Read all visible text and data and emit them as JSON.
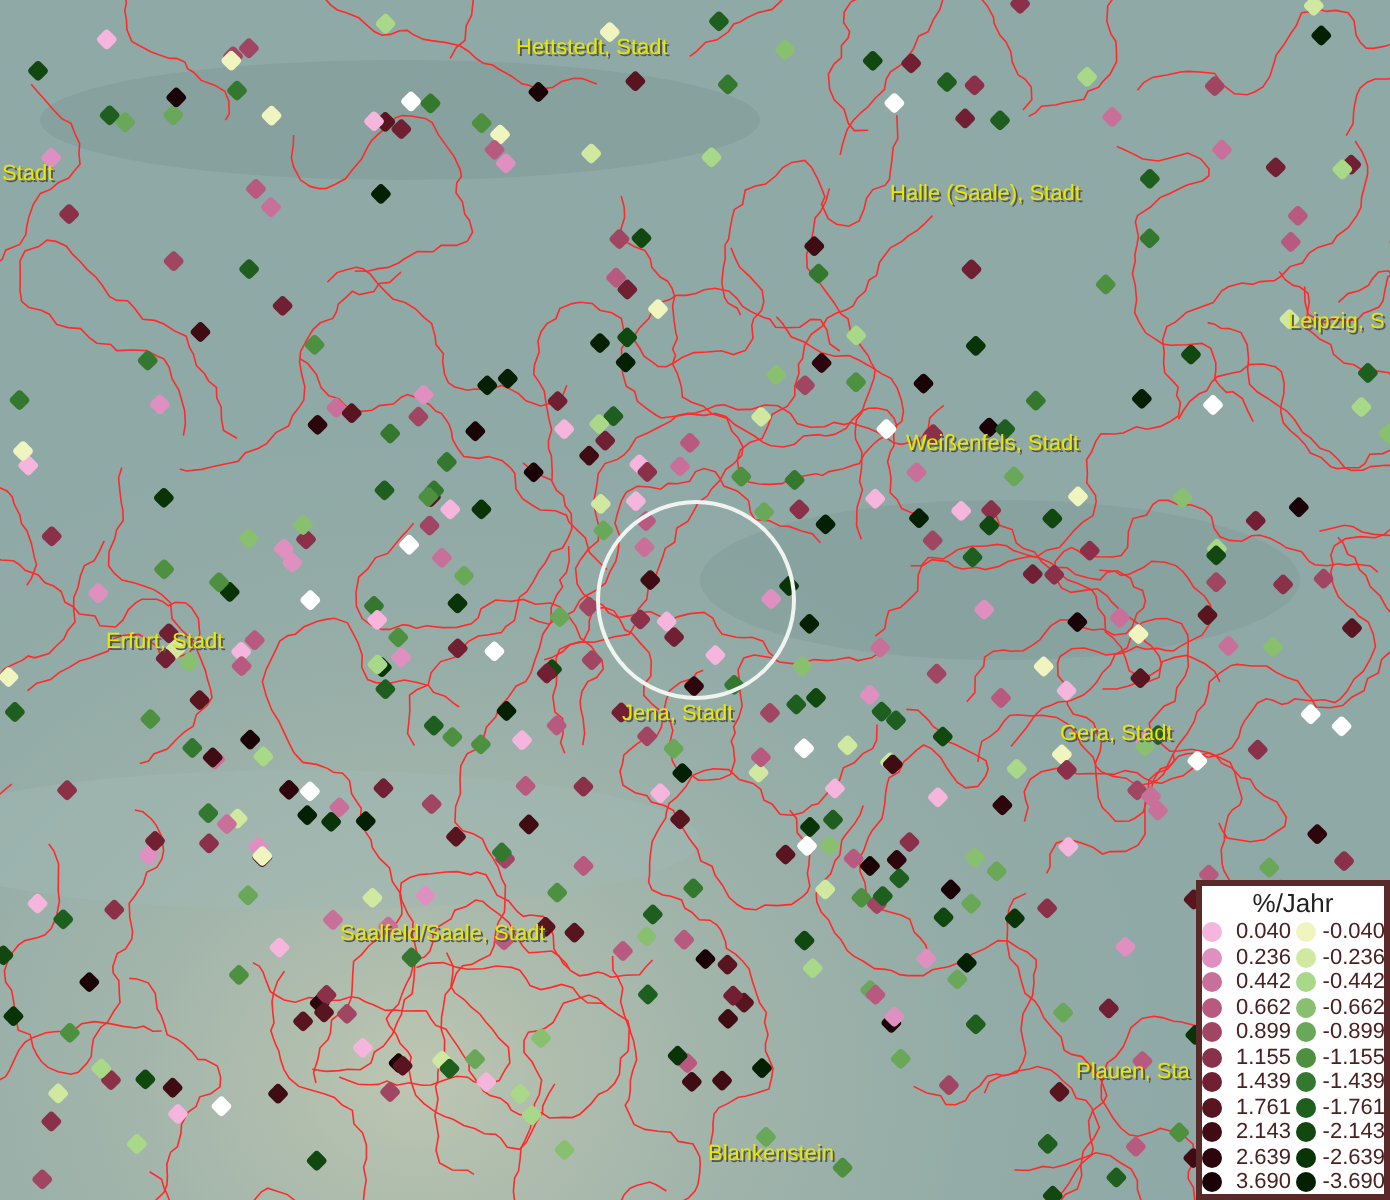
{
  "map": {
    "labels": [
      {
        "text": "Hettstedt, Stadt"
      },
      {
        "text": "Stadt"
      },
      {
        "text": "Halle (Saale), Stadt"
      },
      {
        "text": "Leipzig, S"
      },
      {
        "text": "Weißenfels, Stadt"
      },
      {
        "text": "Erfurt, Stadt"
      },
      {
        "text": "Jena, Stadt"
      },
      {
        "text": "Gera, Stadt"
      },
      {
        "text": "Saalfeld/Saale, Stadt"
      },
      {
        "text": "Plauen, Sta"
      },
      {
        "text": "Blankenstein"
      }
    ]
  },
  "legend": {
    "title": "%/Jahr",
    "positive": [
      {
        "label": "0.040",
        "color": "#f5b5dc"
      },
      {
        "label": "0.236",
        "color": "#e090c0"
      },
      {
        "label": "0.442",
        "color": "#c8709a"
      },
      {
        "label": "0.662",
        "color": "#b85a80"
      },
      {
        "label": "0.899",
        "color": "#a04562"
      },
      {
        "label": "1.155",
        "color": "#8a3048"
      },
      {
        "label": "1.439",
        "color": "#702032"
      },
      {
        "label": "1.761",
        "color": "#581520"
      },
      {
        "label": "2.143",
        "color": "#400c14"
      },
      {
        "label": "2.639",
        "color": "#2c060c"
      },
      {
        "label": "3.690",
        "color": "#1a0306"
      }
    ],
    "negative": [
      {
        "label": "-0.040",
        "color": "#f0f5c0"
      },
      {
        "label": "-0.236",
        "color": "#d0e8a0"
      },
      {
        "label": "-0.442",
        "color": "#a8d888"
      },
      {
        "label": "-0.662",
        "color": "#88c070"
      },
      {
        "label": "-0.899",
        "color": "#68a858"
      },
      {
        "label": "-1.155",
        "color": "#4c9040"
      },
      {
        "label": "-1.439",
        "color": "#347830"
      },
      {
        "label": "-1.761",
        "color": "#1e5e1e"
      },
      {
        "label": "-2.143",
        "color": "#104810"
      },
      {
        "label": "-2.639",
        "color": "#083408"
      },
      {
        "label": "-3.690",
        "color": "#032003"
      }
    ]
  }
}
